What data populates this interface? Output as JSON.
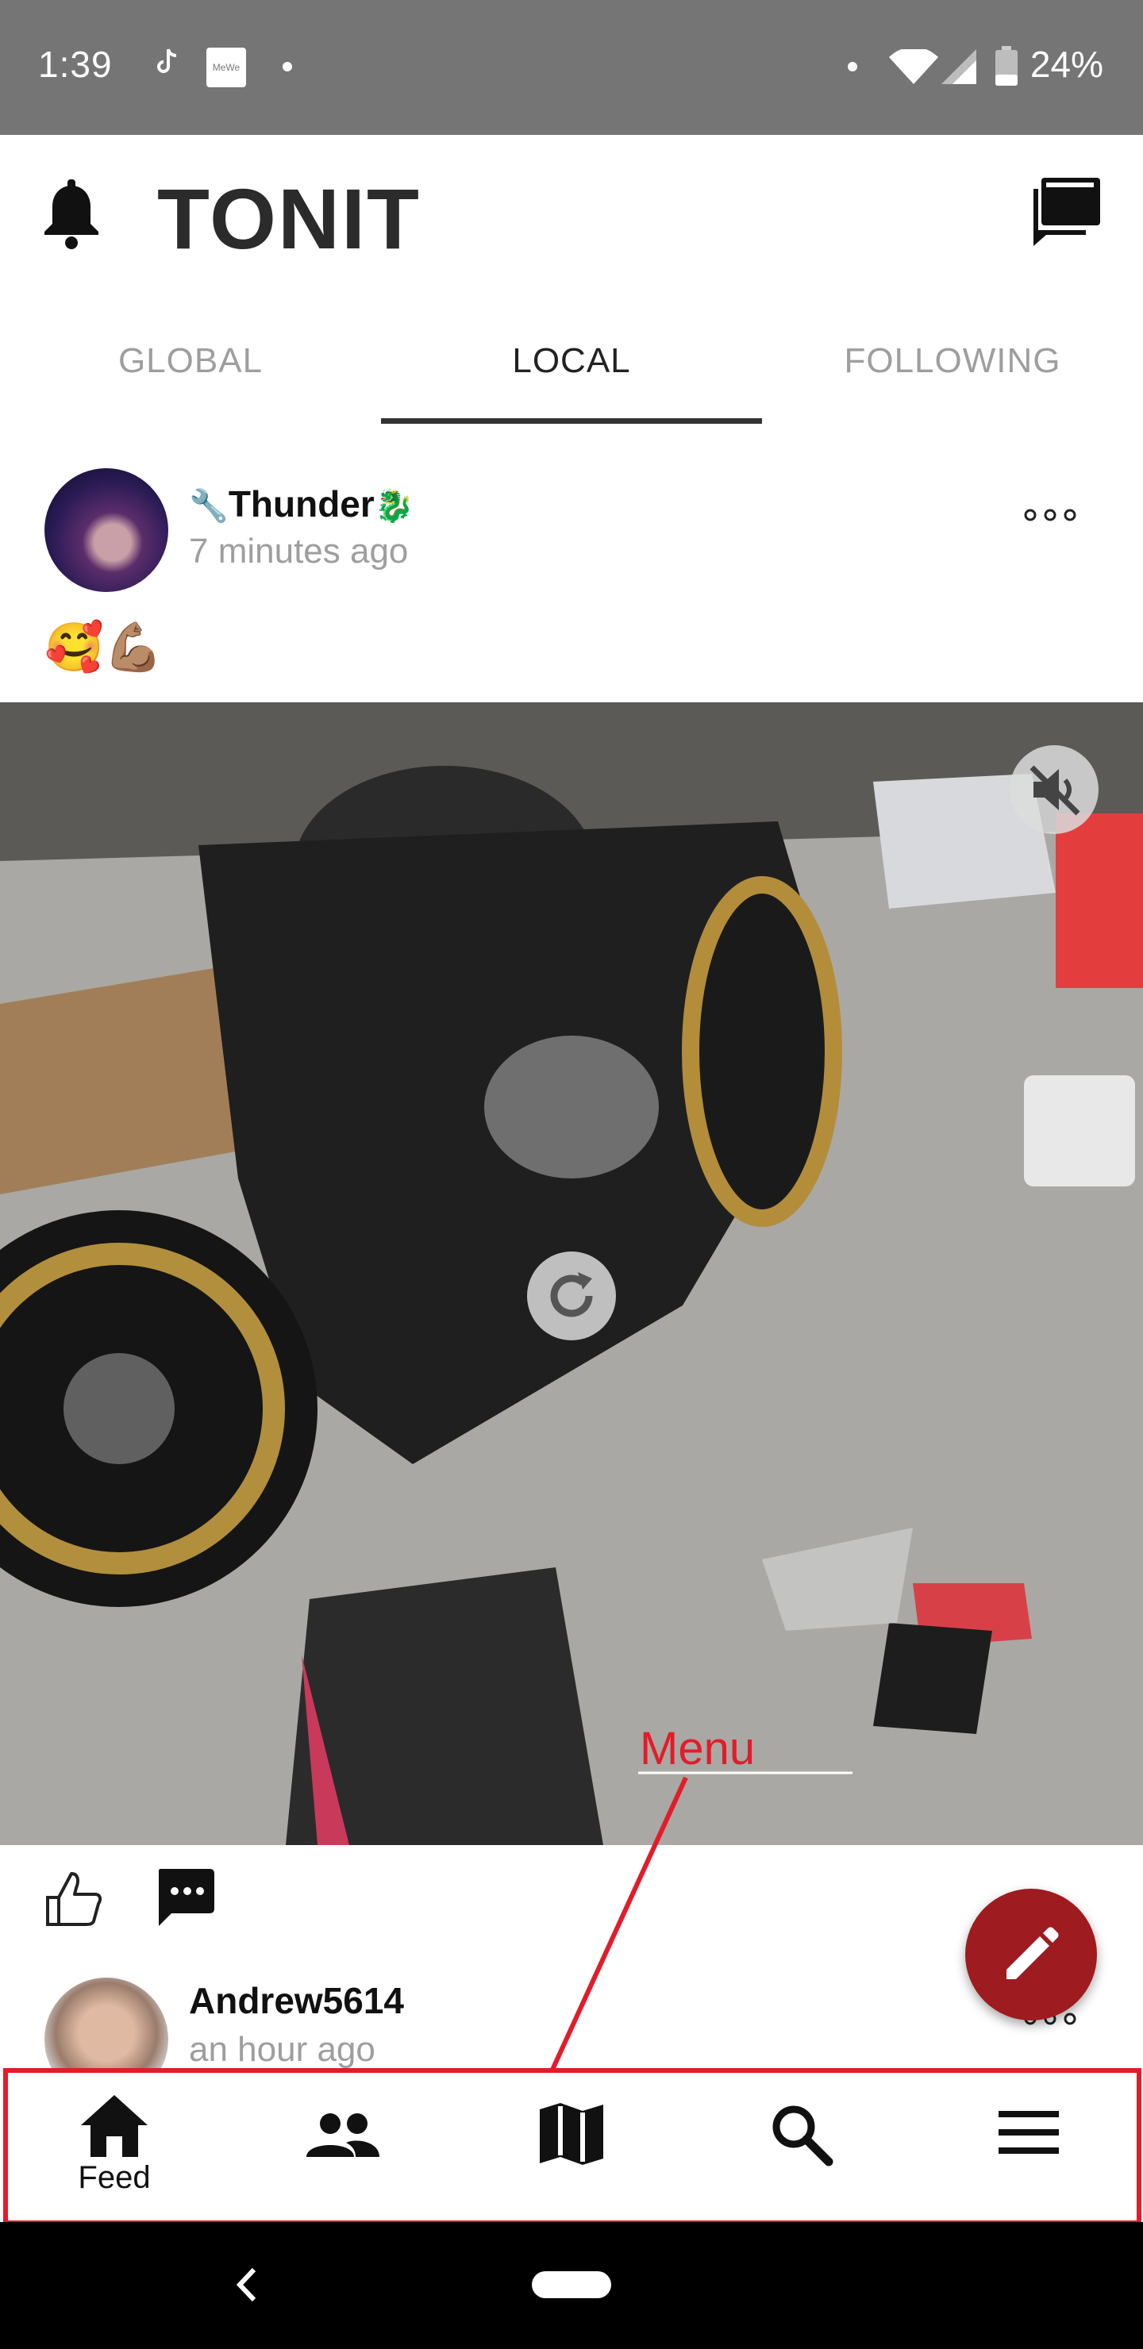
{
  "status_bar": {
    "time": "1:39",
    "notification_icons": [
      "tiktok-icon",
      "mewe-icon",
      "dot-icon"
    ],
    "mewe_text": "MeWe",
    "battery": "24%",
    "system_icons": [
      "dot-icon",
      "wifi-icon",
      "signal-icon",
      "battery-icon"
    ]
  },
  "header": {
    "logo": "TONIT",
    "left_icon": "bell-icon",
    "right_icon": "chat-icon"
  },
  "tabs": [
    {
      "label": "GLOBAL",
      "active": false
    },
    {
      "label": "LOCAL",
      "active": true
    },
    {
      "label": "FOLLOWING",
      "active": false
    }
  ],
  "posts": [
    {
      "username": "Thunder",
      "username_prefix": "🔧",
      "username_suffix": "🐉",
      "time": "7 minutes ago",
      "text": "🥰💪🏽",
      "media_icons": [
        "mute-icon",
        "replay-icon"
      ]
    },
    {
      "username": "Andrew5614",
      "time": "an hour ago"
    }
  ],
  "post_actions": [
    "thumbs-up-icon",
    "comment-icon"
  ],
  "fab_icon": "pencil-icon",
  "annotation": {
    "label": "Menu",
    "color": "#e21c2a"
  },
  "bottom_nav": [
    {
      "label": "Feed",
      "icon": "home-icon"
    },
    {
      "label": "",
      "icon": "people-icon"
    },
    {
      "label": "",
      "icon": "map-icon"
    },
    {
      "label": "",
      "icon": "search-icon"
    },
    {
      "label": "",
      "icon": "menu-icon"
    }
  ],
  "colors": {
    "status_bar": "#757575",
    "fab": "#9e1b1f",
    "annotation": "#e21c2a",
    "text_muted": "#9e9e9e"
  }
}
